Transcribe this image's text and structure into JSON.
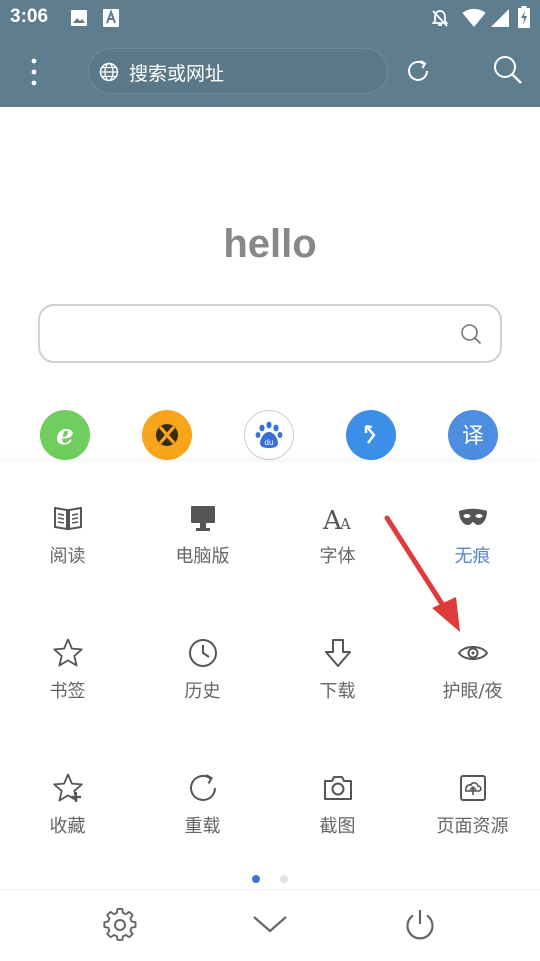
{
  "status_bar": {
    "time": "3:06",
    "left_icons": [
      "image-icon",
      "font-a-icon"
    ],
    "right_icons": [
      "mute-bell-icon",
      "wifi-icon",
      "signal-icon",
      "battery-charging-icon"
    ]
  },
  "toolbar": {
    "url_placeholder": "搜索或网址",
    "bg_color": "#5e7d8e"
  },
  "home": {
    "logo_text": "hello",
    "search_placeholder": ""
  },
  "shortcuts": [
    {
      "icon": "e-browser-icon",
      "color": "#6fce5e"
    },
    {
      "icon": "xbox-icon",
      "color": "#f7a51b"
    },
    {
      "icon": "baidu-icon",
      "color": "#ffffff"
    },
    {
      "icon": "arrow-link-icon",
      "color": "#3b8fe8"
    },
    {
      "icon": "translate-icon",
      "color": "#4d8ee0",
      "glyph": "译"
    }
  ],
  "menu": {
    "rows": [
      [
        {
          "label": "阅读",
          "icon": "book-icon"
        },
        {
          "label": "电脑版",
          "icon": "desktop-icon"
        },
        {
          "label": "字体",
          "icon": "font-size-icon"
        },
        {
          "label": "无痕",
          "icon": "mask-icon",
          "active": true
        }
      ],
      [
        {
          "label": "书签",
          "icon": "star-icon"
        },
        {
          "label": "历史",
          "icon": "clock-icon"
        },
        {
          "label": "下载",
          "icon": "download-arrow-icon"
        },
        {
          "label": "护眼/夜",
          "icon": "eye-icon"
        }
      ],
      [
        {
          "label": "收藏",
          "icon": "star-add-icon"
        },
        {
          "label": "重载",
          "icon": "reload-icon"
        },
        {
          "label": "截图",
          "icon": "camera-icon"
        },
        {
          "label": "页面资源",
          "icon": "page-resource-icon"
        }
      ]
    ],
    "active_color": "#5b85c9",
    "page_indicator": {
      "pages": 2,
      "current": 1
    }
  },
  "bottom_bar": {
    "icons": [
      "settings-icon",
      "collapse-chevron-icon",
      "power-icon"
    ]
  },
  "annotation": {
    "color": "#e03a3a",
    "shape": "red arrow pointing to 护眼/夜"
  }
}
